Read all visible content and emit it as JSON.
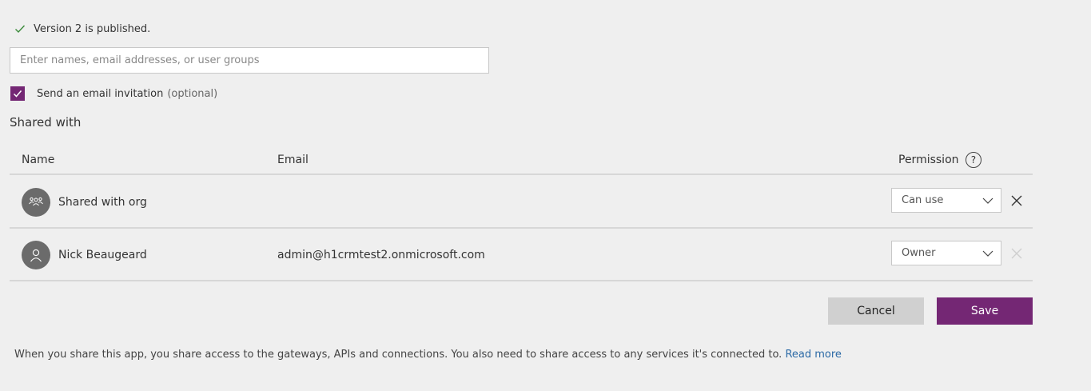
{
  "status": {
    "icon": "checkmark-icon",
    "text": "Version 2 is published."
  },
  "search": {
    "placeholder": "Enter names, email addresses, or user groups",
    "value": ""
  },
  "invite": {
    "checked": true,
    "label": "Send an email invitation",
    "optional": "(optional)"
  },
  "shared_with": {
    "title": "Shared with",
    "columns": {
      "name": "Name",
      "email": "Email",
      "permission": "Permission",
      "help": "?"
    },
    "rows": [
      {
        "avatar_icon": "group-icon",
        "name": "Shared with org",
        "email": "",
        "permission": "Can use",
        "removable": true
      },
      {
        "avatar_icon": "person-icon",
        "name": "Nick Beaugeard",
        "email": "admin@h1crmtest2.onmicrosoft.com",
        "permission": "Owner",
        "removable": false
      }
    ]
  },
  "actions": {
    "cancel": "Cancel",
    "save": "Save"
  },
  "footer": {
    "text": "When you share this app, you share access to the gateways, APIs and connections. You also need to share access to any services it's connected to.",
    "link": "Read more"
  },
  "colors": {
    "accent": "#742774",
    "check": "#3a8a3a",
    "link": "#2c6aa6",
    "background": "#efefef"
  }
}
